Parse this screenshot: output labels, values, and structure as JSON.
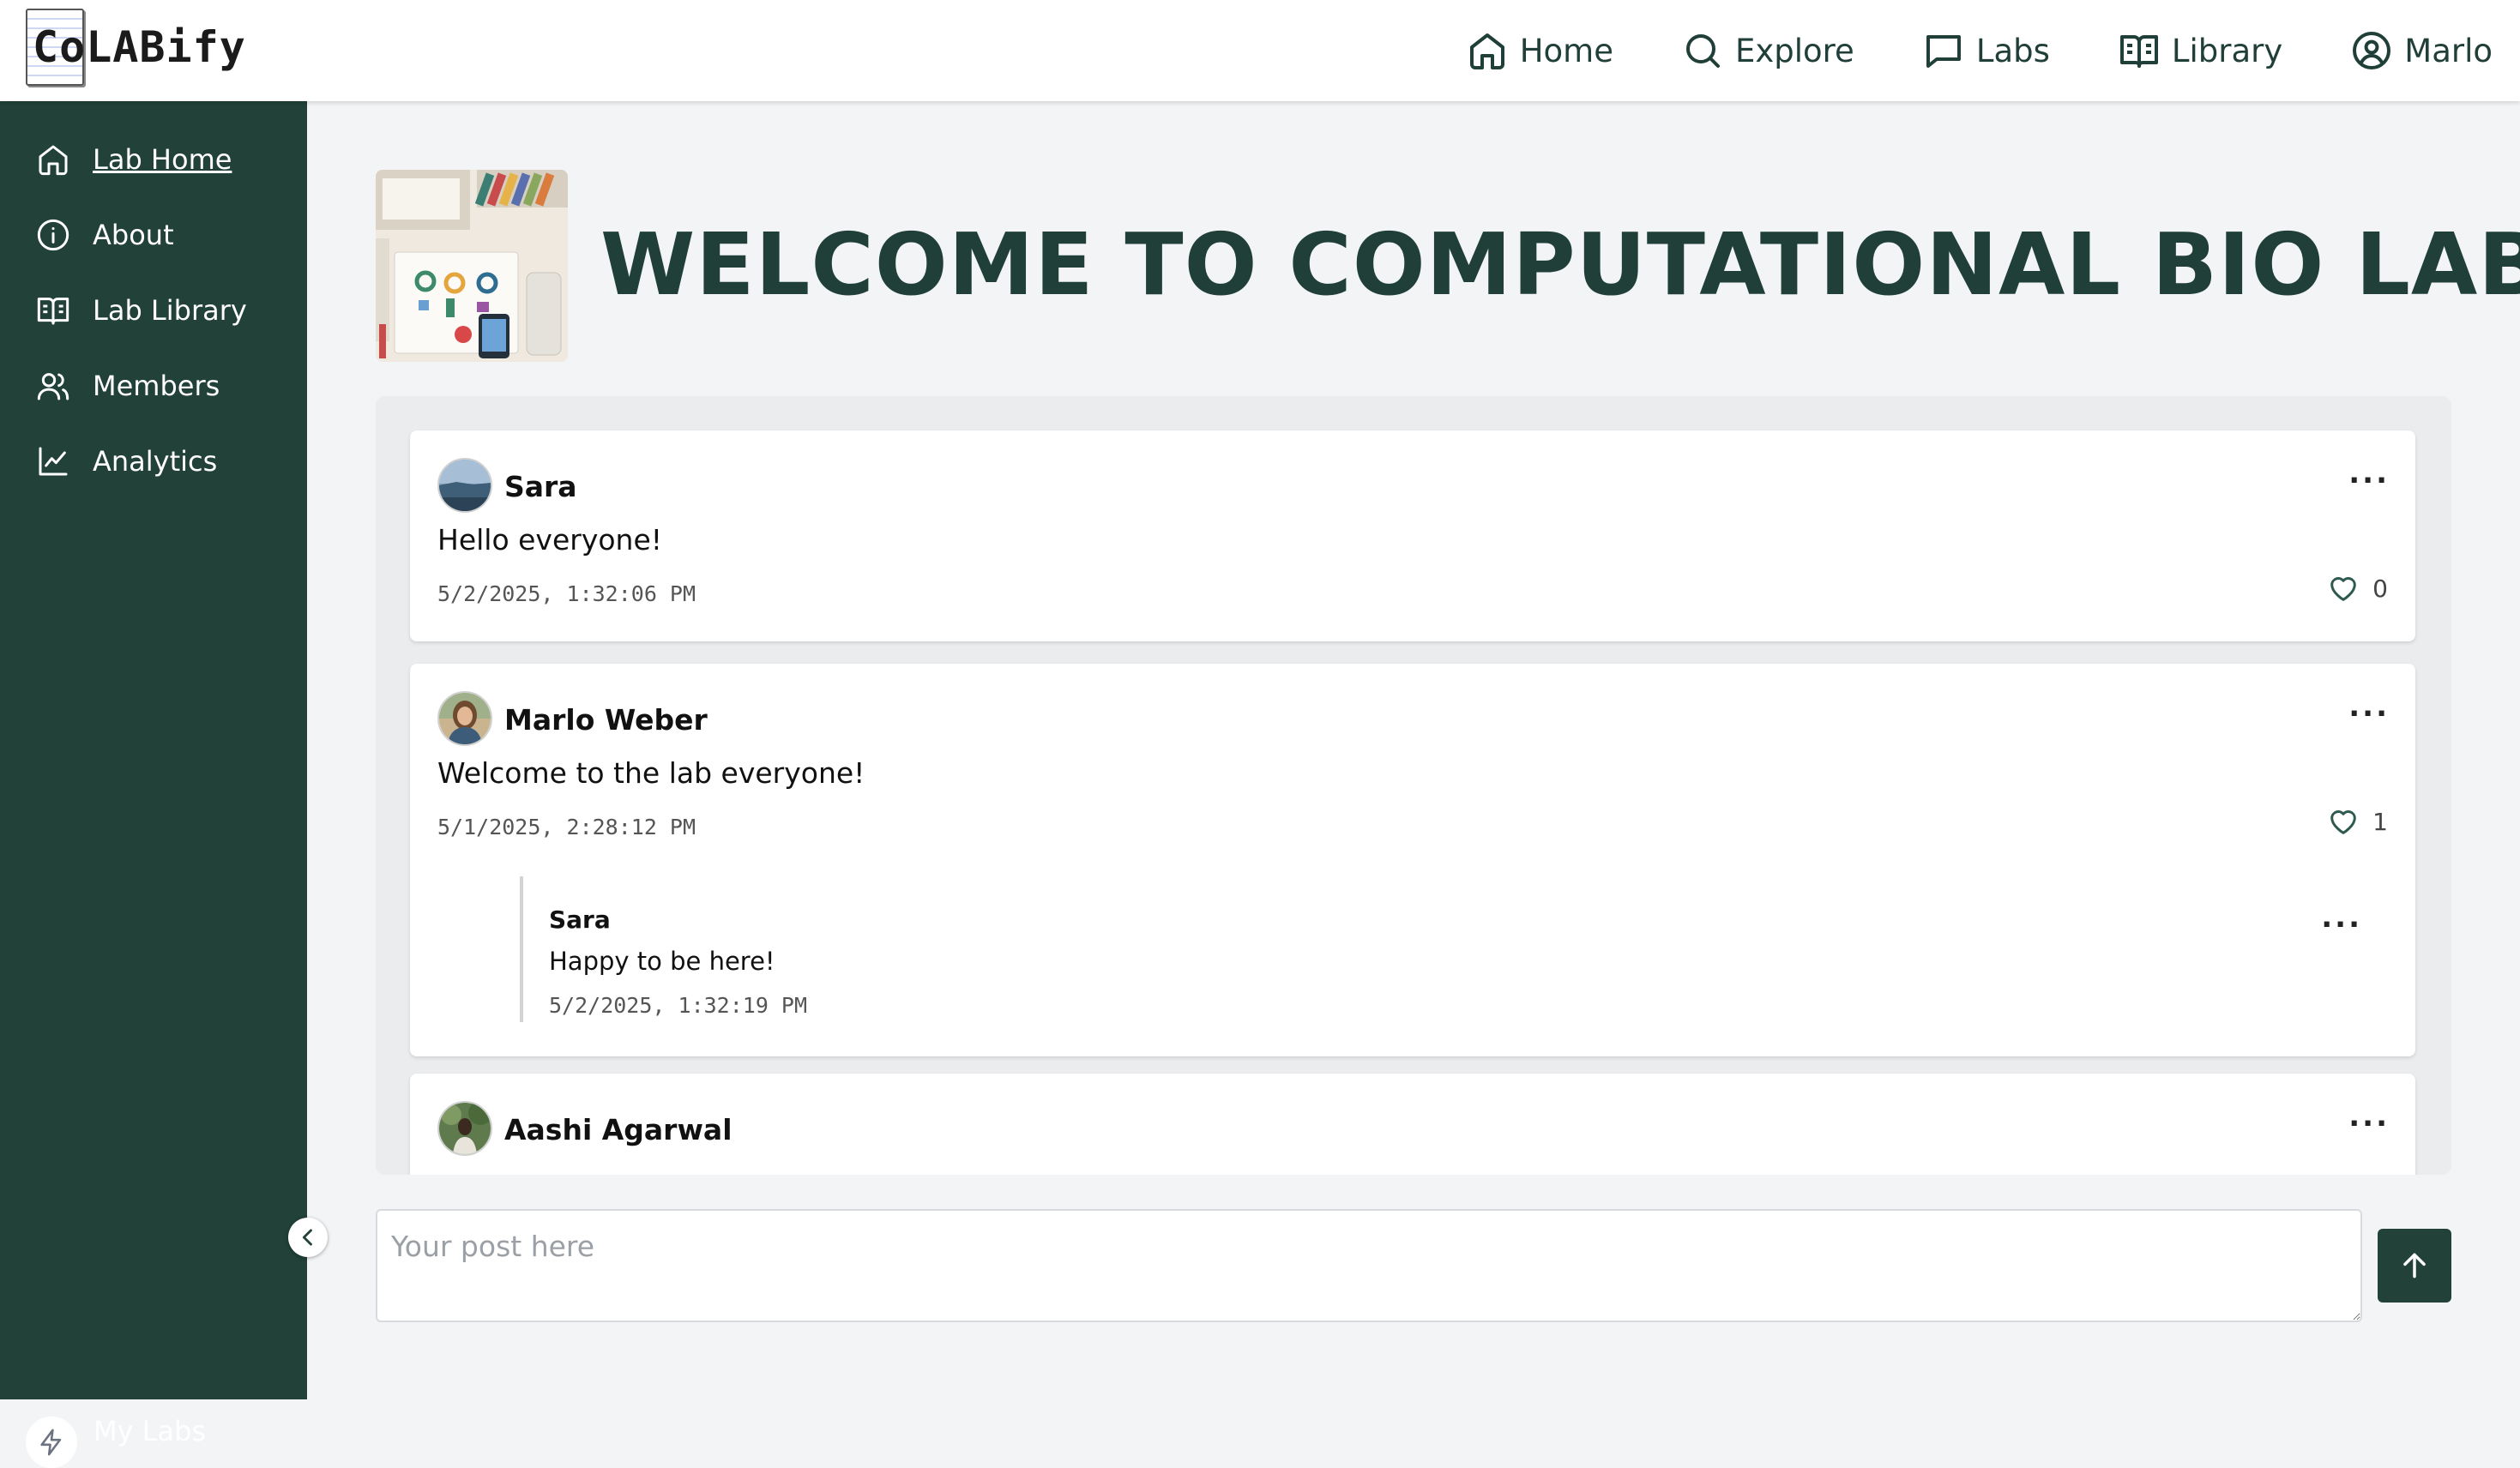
{
  "app": {
    "logo_text": "CoLABify"
  },
  "topnav": {
    "items": [
      {
        "label": "Home",
        "icon": "home-icon"
      },
      {
        "label": "Explore",
        "icon": "search-icon"
      },
      {
        "label": "Labs",
        "icon": "message-square-icon"
      },
      {
        "label": "Library",
        "icon": "book-open-icon"
      },
      {
        "label": "Marlo",
        "icon": "user-circle-icon"
      }
    ]
  },
  "sidebar": {
    "items": [
      {
        "label": "Lab Home",
        "icon": "home-icon",
        "active": true
      },
      {
        "label": "About",
        "icon": "info-icon"
      },
      {
        "label": "Lab Library",
        "icon": "book-open-icon"
      },
      {
        "label": "Members",
        "icon": "users-icon"
      },
      {
        "label": "Analytics",
        "icon": "chart-line-icon"
      }
    ],
    "footer": {
      "label": "My Labs",
      "icon": "bolt-icon"
    },
    "collapse_icon": "chevron-left-icon"
  },
  "lab": {
    "title": "WELCOME TO COMPUTATIONAL BIO LAB"
  },
  "posts": [
    {
      "author": "Sara",
      "content": "Hello everyone!",
      "timestamp": "5/2/2025, 1:32:06 PM",
      "likes": "0",
      "menu": "..."
    },
    {
      "author": "Marlo Weber",
      "content": "Welcome to the lab everyone!",
      "timestamp": "5/1/2025, 2:28:12 PM",
      "likes": "1",
      "menu": "...",
      "replies": [
        {
          "author": "Sara",
          "content": "Happy to be here!",
          "timestamp": "5/2/2025, 1:32:19 PM",
          "menu": "..."
        }
      ]
    },
    {
      "author": "Aashi Agarwal",
      "menu": "..."
    }
  ],
  "composer": {
    "placeholder": "Your post here",
    "send_icon": "arrow-up-icon"
  },
  "colors": {
    "primary": "#214139",
    "title": "#1f3f38",
    "heart": "#2e5a50"
  }
}
